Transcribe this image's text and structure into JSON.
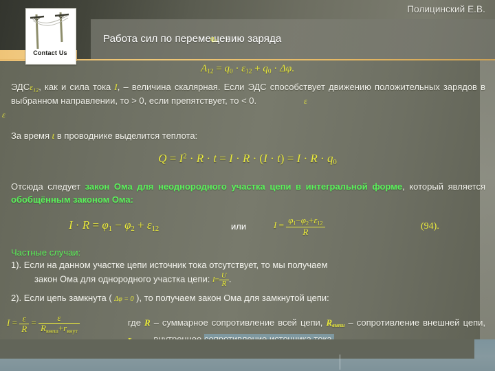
{
  "slide": {
    "author": "Полицинский Е.В.",
    "title": "Работа сил по перемещению заряда",
    "title_symbol": "q₀",
    "title_colon": ":",
    "logo": {
      "caption": "Contact Us",
      "alt": "power-line-poles"
    }
  },
  "formulas": {
    "work": {
      "lhs": "A",
      "lhs_sub": "12",
      "eq": "=",
      "t1": "q",
      "t1_sub": "0",
      "dot1": "·",
      "t2": "ε",
      "t2_sub": "12",
      "plus": "+",
      "t3": "q",
      "t3_sub": "0",
      "dot2": "·",
      "t4": "Δφ",
      "period": "."
    },
    "heat": {
      "Q": "Q",
      "eq1": "=",
      "I": "I",
      "sq": "2",
      "dot1": "·",
      "R": "R",
      "dot2": "·",
      "t": "t",
      "eq2": "=",
      "I2": "I",
      "dot3": "·",
      "R2": "R",
      "dot4": "·",
      "open": "(",
      "I3": "I",
      "dot5": "·",
      "t2": "t",
      "close": ")",
      "eq3": "=",
      "I4": "I",
      "dot6": "·",
      "R3": "R",
      "dot7": "·",
      "q": "q",
      "q_sub": "0"
    },
    "ohm_nonuniform": {
      "I": "I",
      "dot": "·",
      "R": "R",
      "eq": "=",
      "phi1": "φ",
      "phi1_sub": "1",
      "minus": "−",
      "phi2": "φ",
      "phi2_sub": "2",
      "plus": "+",
      "eps": "ε",
      "eps_sub": "12"
    },
    "ohm_nonuniform_solved": {
      "I": "I",
      "eq": "=",
      "num_phi1": "φ",
      "num_phi1_sub": "1",
      "num_minus": "−",
      "num_phi2": "φ",
      "num_phi2_sub": "2",
      "num_plus": "+",
      "num_eps": "ε",
      "num_eps_sub": "12",
      "den": "R"
    },
    "equation_number": "(94).",
    "or_word": "или",
    "ohm_uniform_inline": {
      "I": "I",
      "eq": "=",
      "num": "U",
      "den": "R"
    },
    "closed_condition": "Δφ = 0",
    "ohm_closed": {
      "I": "I",
      "eq1": "=",
      "num1": "ε",
      "den1": "R",
      "eq2": "=",
      "num2": "ε",
      "den2_R": "R",
      "den2_R_sub": "внеш",
      "den2_plus": "+",
      "den2_r": "r",
      "den2_r_sub": "внут"
    }
  },
  "body": {
    "p1": {
      "lead": "ЭДС",
      "eps_symbol": "ε₁₂",
      "rest_a": ", как и сила тока ",
      "var_I": "I",
      "rest_b": ", – величина скалярная. Если ЭДС способствует движению положительных зарядов в выбранном направлении, то ",
      "gt": "> 0, если препятствует, то ",
      "lt": "< 0.",
      "eps_float_1": "ε",
      "eps_float_2": "ε"
    },
    "p2": {
      "pre": "За время ",
      "var_t": "t",
      "post": " в проводнике выделится теплота:"
    },
    "p3": {
      "pre": "Отсюда следует ",
      "green1": "закон Ома для неоднородного участка цепи в интегральной форме",
      "mid": ", который является ",
      "green2": "обобщённым законом Ома:"
    },
    "special_cases_title": "Частные случаи:",
    "case1": {
      "marker": "1).",
      "text": "Если на данном участке цепи источник тока отсутствует, то мы получаем",
      "text2": "закон Ома для однородного участка цепи: ",
      "tail": "."
    },
    "case2": {
      "marker": "2).",
      "pre": "Если цепь замкнута ( ",
      "post": " ), то получаем закон Ома для замкнутой цепи:"
    },
    "tail_text": {
      "a": "где ",
      "R": "R",
      "b": " – суммарное сопротивление всей цепи, ",
      "Rvnesh_base": "R",
      "Rvnesh_sub": "внеш",
      "c": " – сопротивление внешней цепи, ",
      "rvnut_base": "r",
      "rvnut_sub": "внут",
      "d": " – внутреннее ",
      "selected": "сопротивление источника тока."
    }
  },
  "colors": {
    "formula_yellow": "#ecec3c",
    "highlight_green": "#5cf05c",
    "body_text": "#f2f2ec",
    "gold_rule": "#e8b96a",
    "bottom_strip": "#7d949d",
    "selection": "#7e98a0"
  }
}
